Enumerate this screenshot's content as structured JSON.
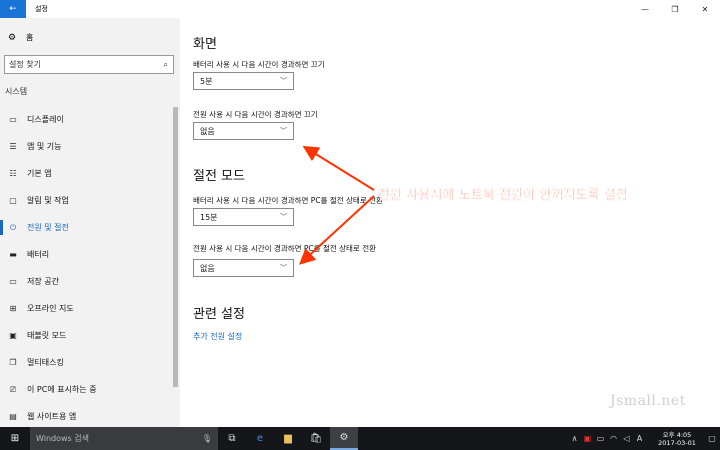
{
  "window": {
    "title": "설정",
    "back_icon": "back-arrow-icon",
    "controls": [
      "minimize",
      "maximize",
      "close"
    ]
  },
  "sidebar": {
    "home_label": "홈",
    "search_placeholder": "설정 찾기",
    "section_label": "시스템",
    "items": [
      {
        "label": "디스플레이",
        "icon": "display-icon"
      },
      {
        "label": "앱 및 기능",
        "icon": "apps-icon"
      },
      {
        "label": "기본 앱",
        "icon": "default-apps-icon"
      },
      {
        "label": "알림 및 작업",
        "icon": "notifications-icon"
      },
      {
        "label": "전원 및 절전",
        "icon": "power-icon",
        "active": true
      },
      {
        "label": "배터리",
        "icon": "battery-icon"
      },
      {
        "label": "저장 공간",
        "icon": "storage-icon"
      },
      {
        "label": "오프라인 지도",
        "icon": "offline-maps-icon"
      },
      {
        "label": "태블릿 모드",
        "icon": "tablet-mode-icon"
      },
      {
        "label": "멀티태스킹",
        "icon": "multitasking-icon"
      },
      {
        "label": "이 PC에 표시하는 중",
        "icon": "projecting-icon"
      },
      {
        "label": "웹 사이트용 앱",
        "icon": "apps-for-websites-icon"
      }
    ]
  },
  "main": {
    "screen_heading": "화면",
    "screen_battery_label": "배터리 사용 시 다음 시간이 경과하면 끄기",
    "screen_battery_value": "5분",
    "screen_plugged_label": "전원 사용 시 다음 시간이 경과하면 끄기",
    "screen_plugged_value": "없음",
    "sleep_heading": "절전 모드",
    "sleep_battery_label": "배터리 사용 시 다음 시간이 경과하면 PC를 절전 상태로 전환",
    "sleep_battery_value": "15분",
    "sleep_plugged_label": "전원 사용 시 다음 시간이 경과하면 PC를 절전 상태로 전환",
    "sleep_plugged_value": "없음",
    "related_heading": "관련 설정",
    "related_link": "추가 전원 설정"
  },
  "annotation": {
    "text": "전원 사용시에 노트북 전원이 안꺼지도록 설정",
    "color": "#ff3300"
  },
  "watermark": "Jsmall.net",
  "taskbar": {
    "search_placeholder": "Windows 검색",
    "clock_time": "오후 4:05",
    "clock_date": "2017-03-01"
  },
  "colors": {
    "accent": "#1a66c0",
    "titlebar_back": "#1a73d6",
    "sidebar_bg": "#f2f2f2",
    "taskbar_bg": "#14161a"
  }
}
